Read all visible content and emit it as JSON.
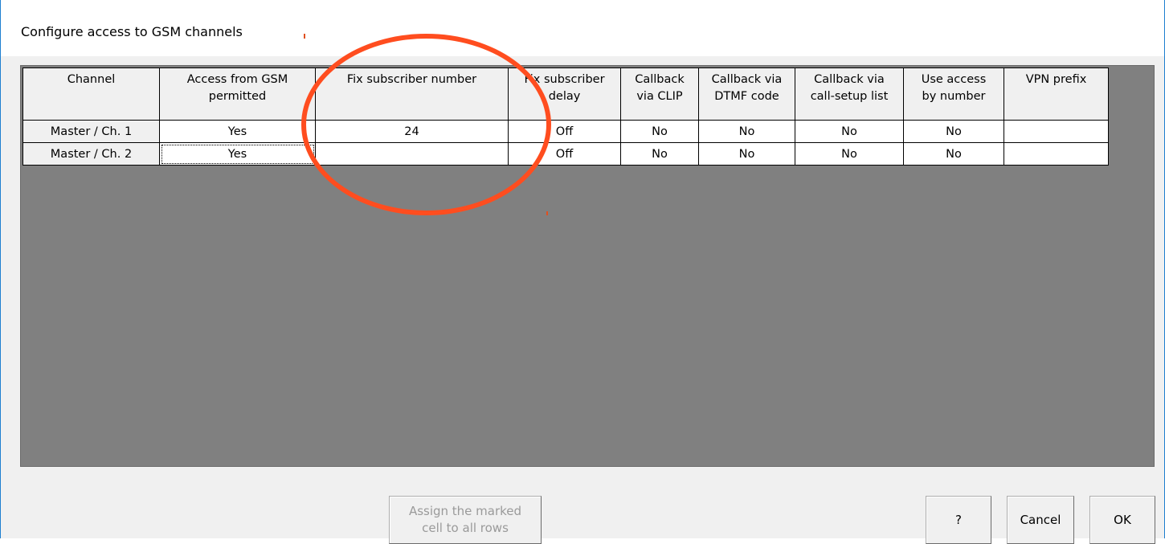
{
  "window": {
    "title": "Configure access to GSM channels"
  },
  "grid": {
    "columns": [
      "Channel",
      "Access from GSM\npermitted",
      "Fix subscriber number",
      "Fix subscriber\ndelay",
      "Callback\nvia CLIP",
      "Callback via\nDTMF code",
      "Callback via\ncall-setup list",
      "Use access\nby number",
      "VPN prefix"
    ],
    "rows": [
      [
        "Master / Ch. 1",
        "Yes",
        "24",
        "Off",
        "No",
        "No",
        "No",
        "No",
        ""
      ],
      [
        "Master / Ch. 2",
        "Yes",
        "",
        "Off",
        "No",
        "No",
        "No",
        "No",
        ""
      ]
    ]
  },
  "buttons": {
    "assign": "Assign the marked\ncell to all rows",
    "help": "?",
    "cancel": "Cancel",
    "ok": "OK"
  },
  "colors": {
    "annotation": "#ff4d1f",
    "grid_background": "#808080",
    "window_border": "#1e7fd0"
  }
}
